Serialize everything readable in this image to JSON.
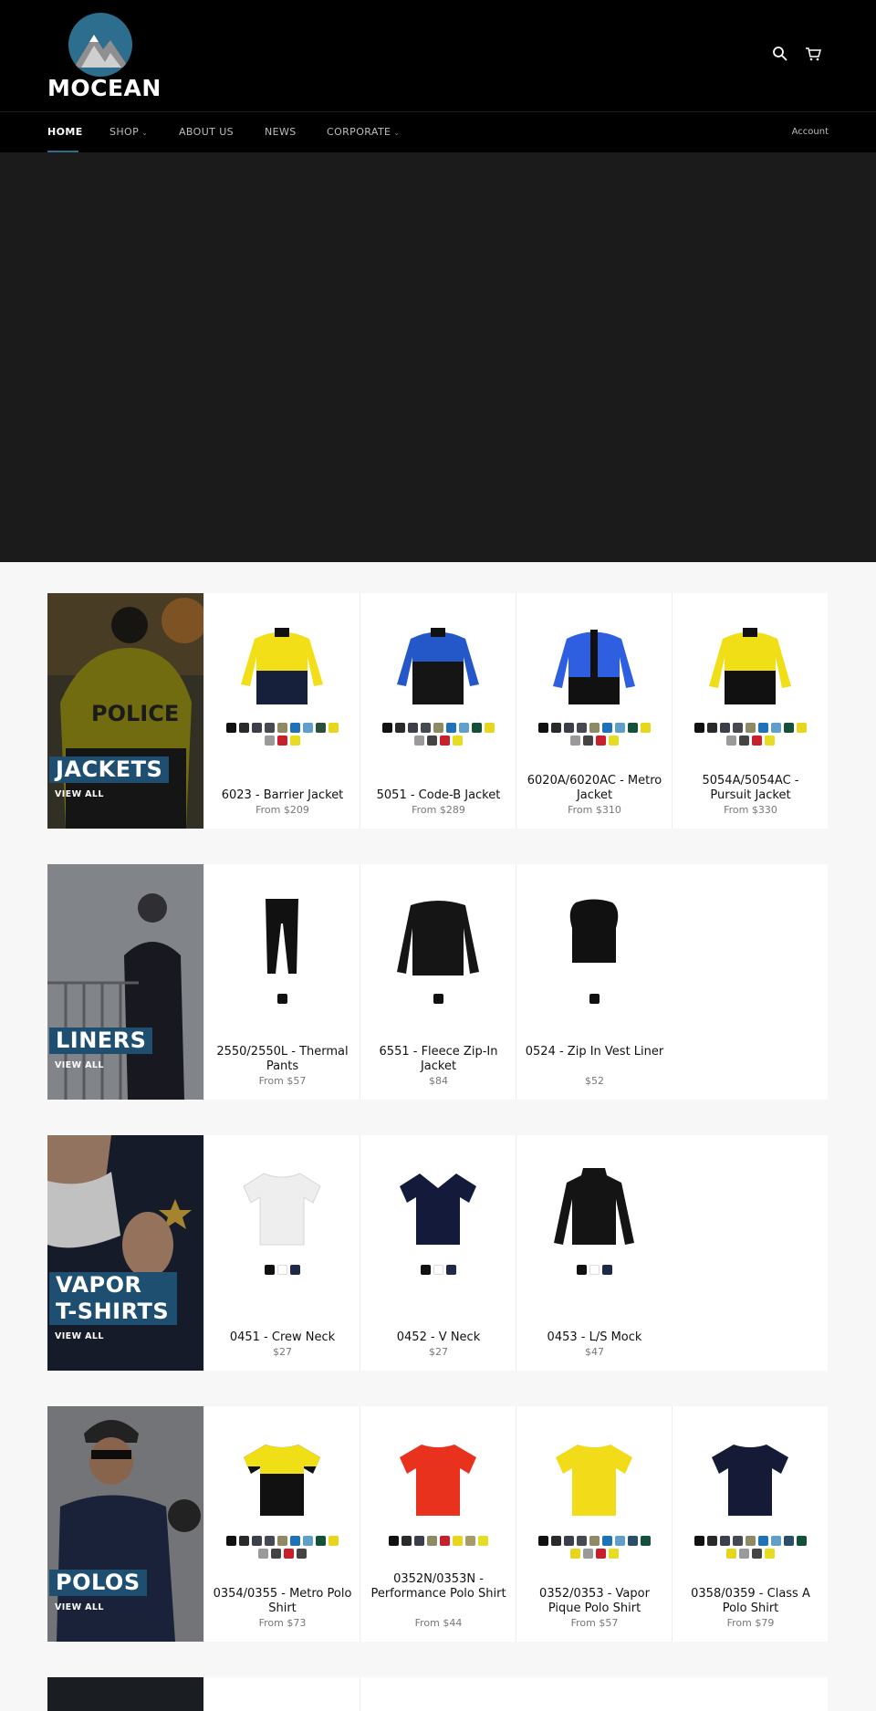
{
  "brand": {
    "name": "MOCEAN"
  },
  "nav": {
    "items": [
      {
        "label": "HOME"
      },
      {
        "label": "SHOP"
      },
      {
        "label": "ABOUT US"
      },
      {
        "label": "NEWS"
      },
      {
        "label": "CORPORATE"
      }
    ],
    "account": "Account"
  },
  "collections": [
    {
      "title": "JACKETS",
      "view_all": "VIEW ALL",
      "products": [
        {
          "title": "6023 - Barrier Jacket",
          "price": "From $209",
          "swatches": [
            "#111111",
            "#2a2a2a",
            "#3a3f4a",
            "#444a4f",
            "#8e8a63",
            "#1d72b8",
            "#5f9fc9",
            "#2b4f3a",
            "#e7d61c",
            "#9a9a9a",
            "#c8202a",
            "#e6dc22"
          ]
        },
        {
          "title": "5051 - Code-B Jacket",
          "price": "From $289",
          "swatches": [
            "#111111",
            "#2a2a2a",
            "#3a3f4a",
            "#444a4f",
            "#8e8a63",
            "#1d72b8",
            "#5f9fc9",
            "#14513a",
            "#e7d61c",
            "#9a9a9a",
            "#444444",
            "#c8202a",
            "#e6dc22"
          ]
        },
        {
          "title": "6020A/6020AC - Metro Jacket",
          "price": "From $310",
          "swatches": [
            "#111111",
            "#2a2a2a",
            "#3a3f4a",
            "#444a4f",
            "#8e8a63",
            "#1d72b8",
            "#5f9fc9",
            "#14513a",
            "#e7d61c",
            "#9a9a9a",
            "#444444",
            "#c8202a",
            "#e6dc22"
          ]
        },
        {
          "title": "5054A/5054AC - Pursuit Jacket",
          "price": "From $330",
          "swatches": [
            "#111111",
            "#2a2a2a",
            "#3a3f4a",
            "#444a4f",
            "#8e8a63",
            "#1d72b8",
            "#5f9fc9",
            "#14513a",
            "#e7d61c",
            "#9a9a9a",
            "#444444",
            "#c8202a",
            "#e6dc22"
          ]
        }
      ]
    },
    {
      "title": "LINERS",
      "view_all": "VIEW ALL",
      "products": [
        {
          "title": "2550/2550L - Thermal Pants",
          "price": "From $57",
          "swatches": [
            "#111111"
          ]
        },
        {
          "title": "6551 - Fleece Zip-In Jacket",
          "price": "$84",
          "swatches": [
            "#111111"
          ]
        },
        {
          "title": "0524 - Zip In Vest Liner",
          "price": "$52",
          "swatches": [
            "#111111"
          ]
        }
      ]
    },
    {
      "title": "VAPOR T-SHIRTS",
      "view_all": "VIEW ALL",
      "products": [
        {
          "title": "0451 - Crew Neck",
          "price": "$27",
          "swatches": [
            "#111111",
            "#ffffff",
            "#1e2a48"
          ]
        },
        {
          "title": "0452 - V Neck",
          "price": "$27",
          "swatches": [
            "#111111",
            "#ffffff",
            "#1e2a48"
          ]
        },
        {
          "title": "0453 - L/S Mock",
          "price": "$47",
          "swatches": [
            "#111111",
            "#ffffff",
            "#1e2a48"
          ]
        }
      ]
    },
    {
      "title": "POLOS",
      "view_all": "VIEW ALL",
      "products": [
        {
          "title": "0354/0355 - Metro Polo Shirt",
          "price": "From $73",
          "swatches": [
            "#111111",
            "#2a2a2a",
            "#3a3f4a",
            "#444a4f",
            "#8e8a63",
            "#1d72b8",
            "#5f9fc9",
            "#14513a",
            "#e7d61c",
            "#9a9a9a",
            "#444444",
            "#c8202a",
            "#444444"
          ]
        },
        {
          "title": "0352N/0353N - Performance Polo Shirt",
          "price": "From $44",
          "swatches": [
            "#111111",
            "#2a2a2a",
            "#3a3f4a",
            "#8e8a63",
            "#c8202a",
            "#e7d61c",
            "#a99a6c",
            "#e6dc22"
          ]
        },
        {
          "title": "0352/0353 - Vapor Pique Polo Shirt",
          "price": "From $57",
          "swatches": [
            "#111111",
            "#2a2a2a",
            "#3a3f4a",
            "#444a4f",
            "#8e8a63",
            "#1d72b8",
            "#5f9fc9",
            "#2b4f6a",
            "#14513a",
            "#e7d61c",
            "#9a9a9a",
            "#c8202a",
            "#e6dc22"
          ]
        },
        {
          "title": "0358/0359 - Class A Polo Shirt",
          "price": "From $79",
          "swatches": [
            "#111111",
            "#2a2a2a",
            "#3a3f4a",
            "#444a4f",
            "#8e8a63",
            "#1d72b8",
            "#5f9fc9",
            "#2b4f6a",
            "#14513a",
            "#e7d61c",
            "#9a9a9a",
            "#444444",
            "#e6dc22"
          ]
        }
      ]
    }
  ]
}
